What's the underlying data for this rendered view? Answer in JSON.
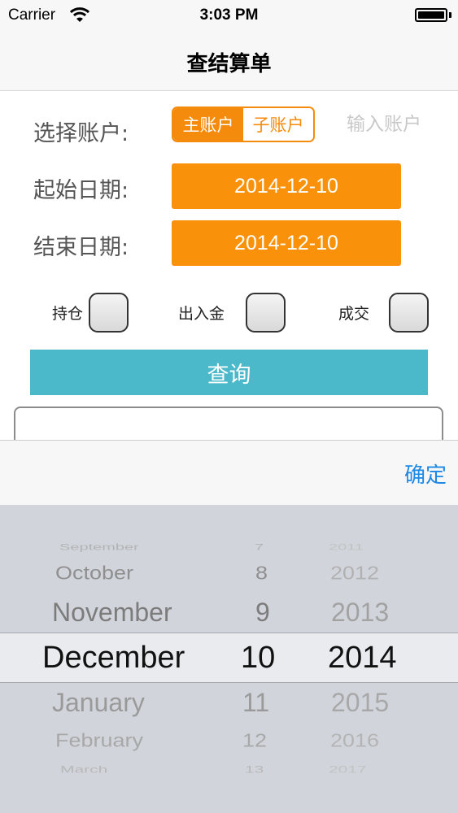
{
  "status_bar": {
    "carrier": "Carrier",
    "time": "3:03 PM",
    "wifi_icon": "wifi-icon",
    "battery_icon": "battery-icon"
  },
  "nav": {
    "title": "查结算单"
  },
  "form": {
    "account_label": "选择账户:",
    "segments": [
      "主账户",
      "子账户"
    ],
    "selected_segment": "主账户",
    "account_input_placeholder": "输入账户",
    "account_input_value": "",
    "start_date_label": "起始日期:",
    "start_date_value": "2014-12-10",
    "end_date_label": "结束日期:",
    "end_date_value": "2014-12-10"
  },
  "filters": [
    {
      "label": "持仓",
      "checked": false
    },
    {
      "label": "出入金",
      "checked": false
    },
    {
      "label": "成交",
      "checked": false
    }
  ],
  "query_button": "查询",
  "toolbar": {
    "confirm": "确定"
  },
  "picker": {
    "months": [
      "September",
      "October",
      "November",
      "December",
      "January",
      "February",
      "March"
    ],
    "days": [
      "7",
      "8",
      "9",
      "10",
      "11",
      "12",
      "13"
    ],
    "years": [
      "2011",
      "2012",
      "2013",
      "2014",
      "2015",
      "2016",
      "2017"
    ],
    "selected": {
      "month": "December",
      "day": "10",
      "year": "2014"
    }
  },
  "colors": {
    "accent_orange": "#f9910a",
    "query_teal": "#4bb9c9",
    "confirm_blue": "#1e88e5",
    "picker_background": "#d1d5db"
  }
}
